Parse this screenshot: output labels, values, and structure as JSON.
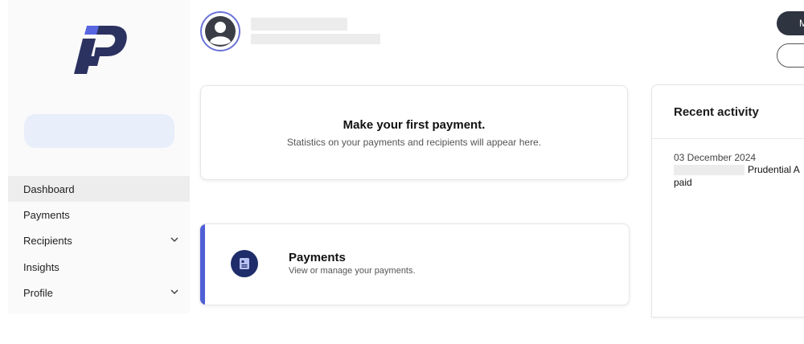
{
  "sidebar": {
    "logo": "pip-logo",
    "nav": [
      {
        "label": "Dashboard",
        "active": true,
        "expandable": false
      },
      {
        "label": "Payments",
        "active": false,
        "expandable": false
      },
      {
        "label": "Recipients",
        "active": false,
        "expandable": true
      },
      {
        "label": "Insights",
        "active": false,
        "expandable": false
      },
      {
        "label": "Profile",
        "active": false,
        "expandable": true
      }
    ],
    "chevron": "⌄"
  },
  "header": {
    "avatar_icon": "user-avatar-icon"
  },
  "first_payment": {
    "title": "Make your first payment.",
    "description": "Statistics on your payments and recipients will appear here."
  },
  "payments_card": {
    "title": "Payments",
    "description": "View or manage your payments.",
    "icon": "document-icon"
  },
  "activity": {
    "heading": "Recent activity",
    "entries": [
      {
        "date": "03 December 2024",
        "payee": "Prudential A",
        "status": "paid"
      }
    ]
  },
  "top_actions": {
    "primary_label": "M"
  },
  "colors": {
    "accent": "#4f5fd6",
    "navy": "#1f2d6b",
    "search_bg": "#e8eefa"
  }
}
